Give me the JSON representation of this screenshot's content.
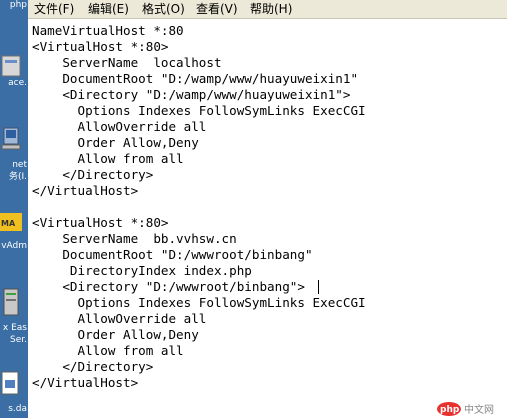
{
  "menu": {
    "file": "文件(F)",
    "edit": "编辑(E)",
    "format": "格式(O)",
    "view": "查看(V)",
    "help": "帮助(H)"
  },
  "desktop_icons": {
    "top": "php",
    "item1": "ace.",
    "item2a": "net",
    "item2b": "务(I.",
    "item3": "vAdm",
    "item4a": "x Eas",
    "item4b": "Ser.",
    "item5": "s.da"
  },
  "editor": {
    "lines": [
      "NameVirtualHost *:80",
      "<VirtualHost *:80>",
      "    ServerName  localhost",
      "    DocumentRoot \"D:/wamp/www/huayuweixin1\"",
      "    <Directory \"D:/wamp/www/huayuweixin1\">",
      "      Options Indexes FollowSymLinks ExecCGI",
      "      AllowOverride all",
      "      Order Allow,Deny",
      "      Allow from all",
      "    </Directory>",
      "</VirtualHost>",
      "",
      "<VirtualHost *:80>",
      "    ServerName  bb.vvhsw.cn",
      "    DocumentRoot \"D:/wwwroot/binbang\"",
      "     DirectoryIndex index.php",
      "    <Directory \"D:/wwwroot/binbang\">",
      "      Options Indexes FollowSymLinks ExecCGI",
      "      AllowOverride all",
      "      Order Allow,Deny",
      "      Allow from all",
      "    </Directory>",
      "</VirtualHost>"
    ]
  },
  "watermark": {
    "logo": "php",
    "site": "中文网"
  },
  "colors": {
    "menubar": "#ece9d8",
    "desktop": "#3a6ea5",
    "php_logo": "#e8322f"
  }
}
